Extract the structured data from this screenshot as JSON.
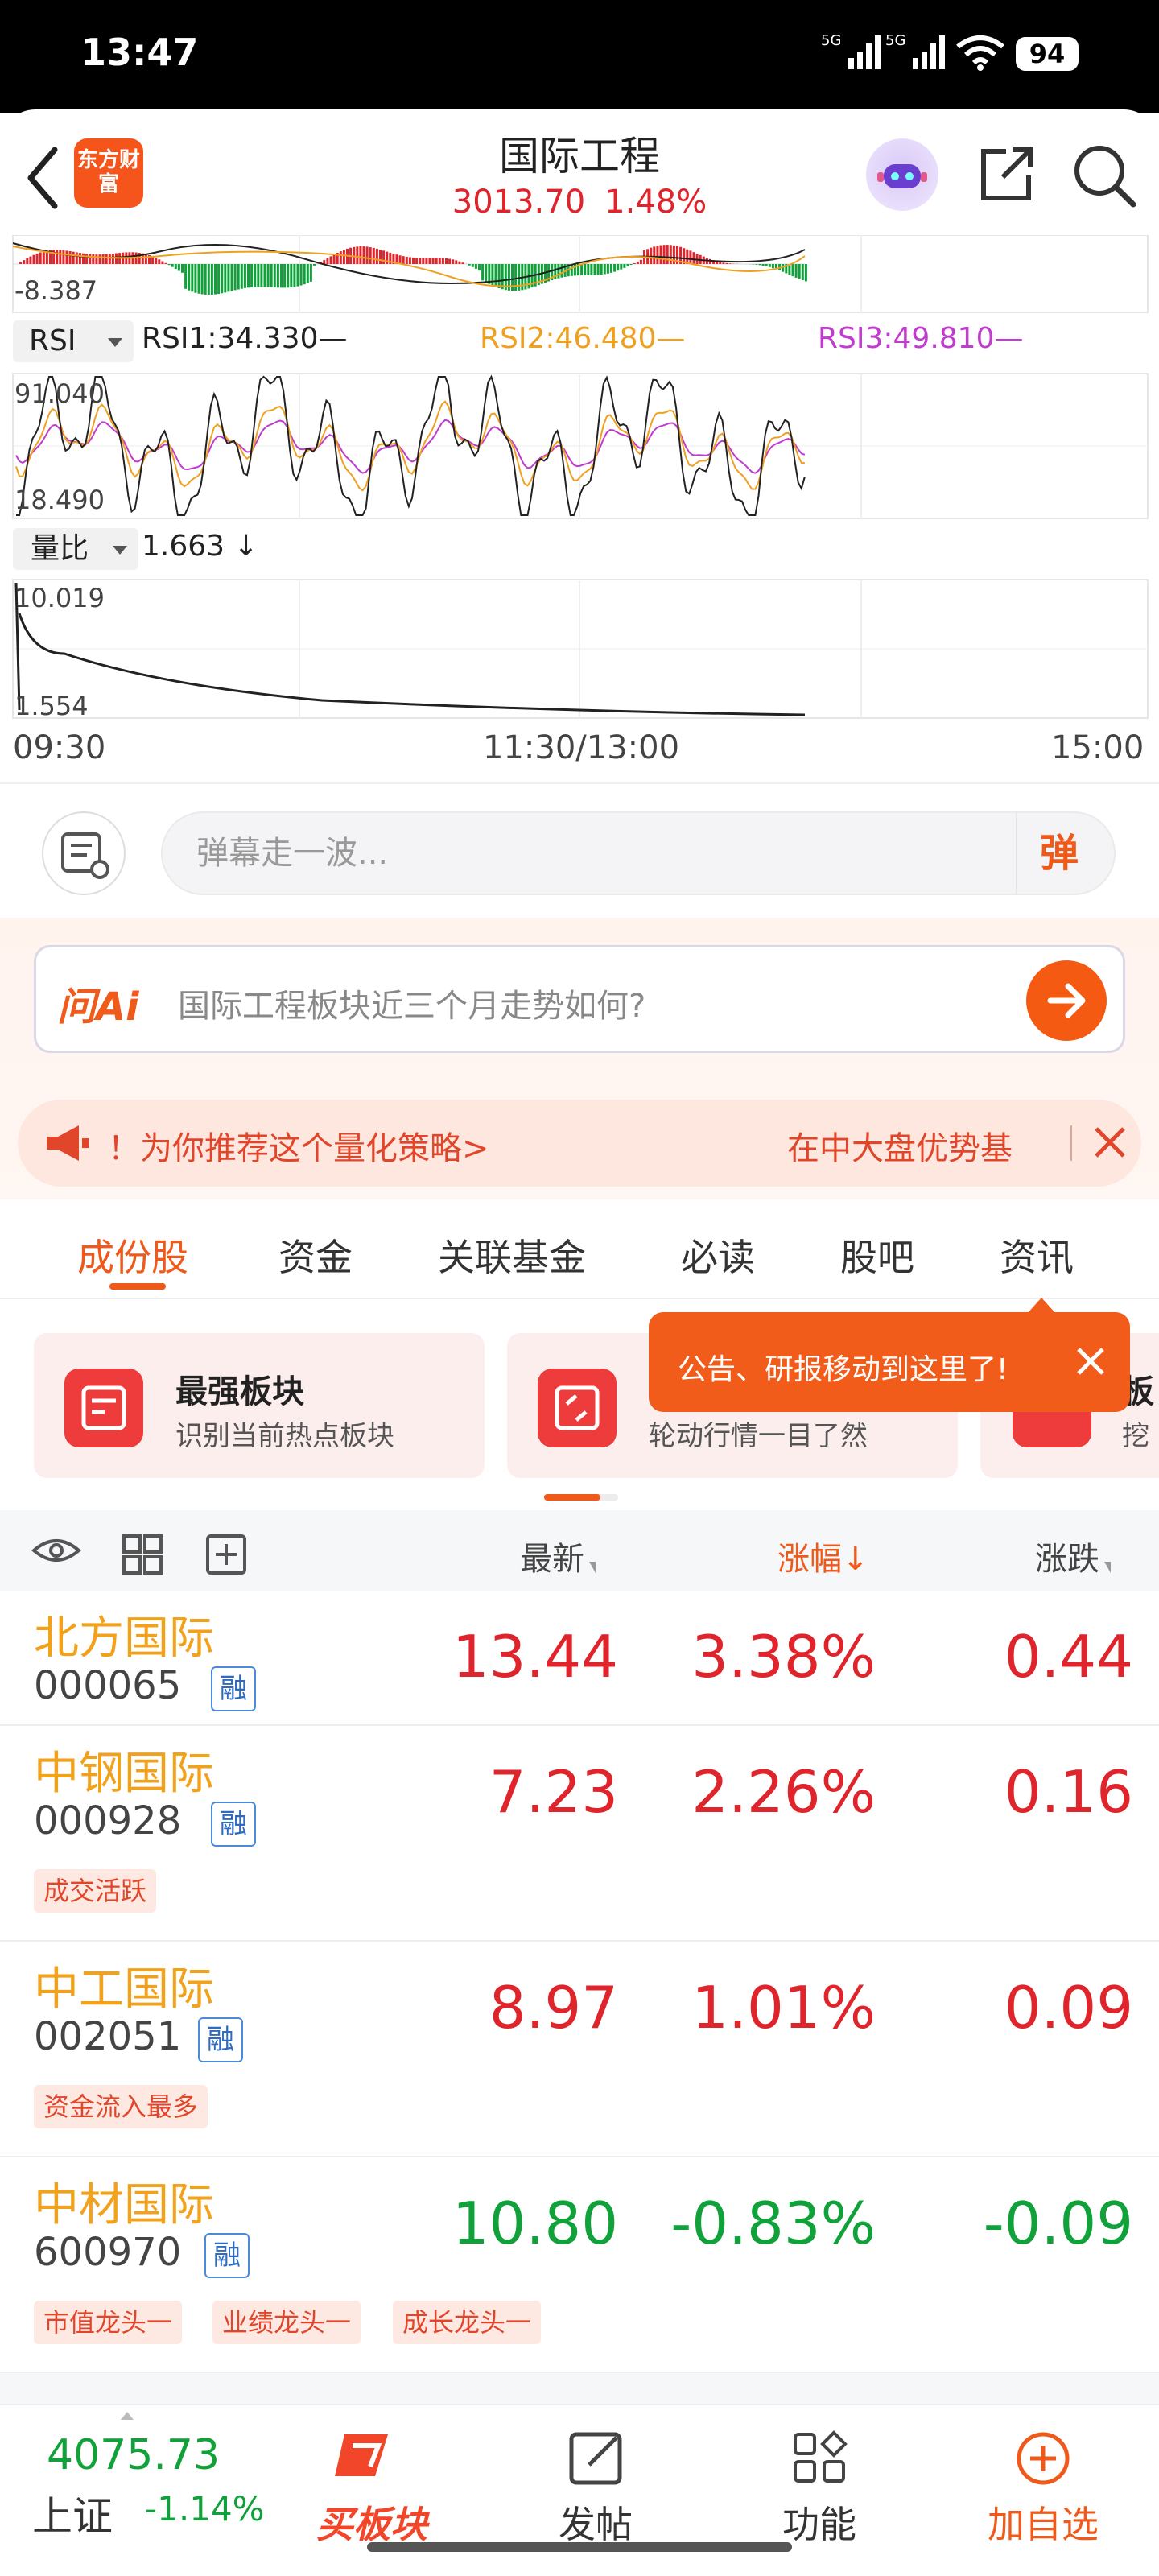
{
  "status": {
    "time": "13:47",
    "battery": "94",
    "net1": "5G",
    "net2": "5G"
  },
  "header": {
    "logo_text": "东方财富",
    "title": "国际工程",
    "price": "3013.70",
    "change_pct": "1.48%"
  },
  "chart": {
    "macd_low": "-8.387",
    "rsi_selector": "RSI",
    "rsi1": "RSI1:34.330—",
    "rsi2": "RSI2:46.480—",
    "rsi3": "RSI3:49.810—",
    "rsi_max": "91.040",
    "rsi_min": "18.490",
    "volume_ratio_selector": "量比",
    "volume_ratio_value": "1.663 ↓",
    "vr_max": "10.019",
    "vr_min": "1.554",
    "times": [
      "09:30",
      "11:30/13:00",
      "15:00"
    ],
    "colors": {
      "rsi1": "#222222",
      "rsi2": "#f0a020",
      "rsi3": "#c03ccf",
      "up": "#e0242c",
      "down": "#10a13a"
    }
  },
  "danmu": {
    "placeholder": "弹幕走一波...",
    "button": "弹"
  },
  "ask_ai": {
    "logo": "问Ai",
    "question": "国际工程板块近三个月走势如何?"
  },
  "promo": {
    "text": "！为你推荐这个量化策略>",
    "text2": "在中大盘优势基"
  },
  "tabs": [
    "成份股",
    "资金",
    "关联基金",
    "必读",
    "股吧",
    "资讯"
  ],
  "cards": [
    {
      "title": "最强板块",
      "subtitle": "识别当前热点板块"
    },
    {
      "title": "",
      "subtitle": "轮动行情一目了然"
    },
    {
      "title": "板",
      "subtitle": "挖"
    }
  ],
  "tooltip": "公告、研报移动到这里了!",
  "table": {
    "headers": {
      "latest": "最新",
      "change_pct": "涨幅",
      "change": "涨跌"
    },
    "rows": [
      {
        "name": "北方国际",
        "code": "000065",
        "badge": "融",
        "price": "13.44",
        "pct": "3.38%",
        "change": "0.44",
        "tags": []
      },
      {
        "name": "中钢国际",
        "code": "000928",
        "badge": "融",
        "price": "7.23",
        "pct": "2.26%",
        "change": "0.16",
        "tags": [
          "成交活跃"
        ]
      },
      {
        "name": "中工国际",
        "code": "002051",
        "badge": "融",
        "price": "8.97",
        "pct": "1.01%",
        "change": "0.09",
        "tags": [
          "资金流入最多"
        ]
      },
      {
        "name": "中材国际",
        "code": "600970",
        "badge": "融",
        "price": "10.80",
        "pct": "-0.83%",
        "change": "-0.09",
        "tags": [
          "市值龙头一",
          "业绩龙头一",
          "成长龙头一"
        ]
      }
    ]
  },
  "bottom": {
    "index_value": "4075.73",
    "index_name": "上证",
    "index_pct": "-1.14%",
    "nav": [
      "买板块",
      "发帖",
      "功能",
      "加自选"
    ]
  }
}
